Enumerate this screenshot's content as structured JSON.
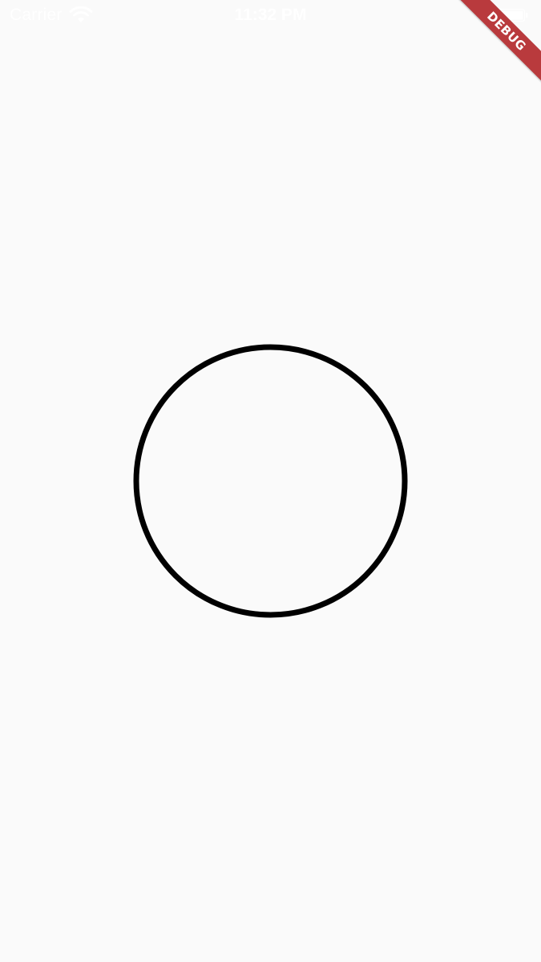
{
  "status_bar": {
    "carrier": "Carrier",
    "time": "11:32 PM",
    "icons": {
      "wifi": "wifi-icon",
      "battery": "battery-icon"
    },
    "text_color": "#ffffff"
  },
  "debug_banner": {
    "label": "DEBUG",
    "color": "#b93a3d"
  },
  "main": {
    "shape": "circle-outline",
    "stroke_color": "#000000",
    "background": "#fafafa"
  }
}
